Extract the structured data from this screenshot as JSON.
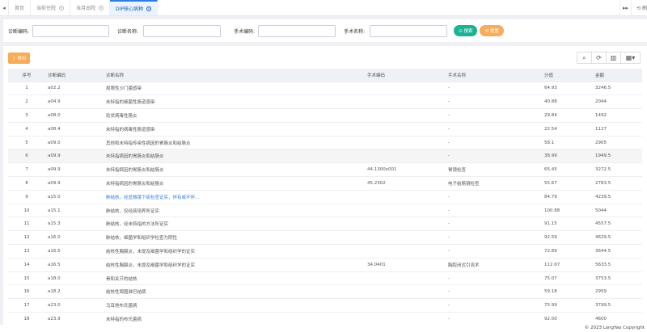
{
  "tabs": {
    "prev": "◂",
    "next": "▸▸",
    "items": [
      {
        "label": "首页"
      },
      {
        "label": "当前住院"
      },
      {
        "label": "当月出院"
      },
      {
        "label": "DIP核心病种"
      }
    ],
    "refresh_label": "⟲ 刷"
  },
  "search": {
    "diag_code_label": "诊断编码:",
    "diag_name_label": "诊断名称:",
    "op_code_label": "手术编码:",
    "op_name_label": "手术名称:",
    "search_button": "⊙ 搜索",
    "reset_button": "⟲ 重置"
  },
  "toolbar": {
    "export_label": "⇪ 导出",
    "search_icon": "⌕",
    "refresh_icon": "⟳",
    "columns_icon": "▥",
    "grid_icon": "▦▾"
  },
  "table": {
    "headers": [
      "序号",
      "诊断编码",
      "诊断名称",
      "手术编码",
      "手术名称",
      "分值",
      "金额"
    ],
    "rows": [
      {
        "no": "1",
        "dcode": "a02.2",
        "dname": "局限性沙门菌感染",
        "ocode": "",
        "oname": "-",
        "score": "64.93",
        "amount": "3246.5",
        "link": false
      },
      {
        "no": "2",
        "dcode": "a04.9",
        "dname": "未特指的细菌性肠道感染",
        "ocode": "",
        "oname": "-",
        "score": "40.88",
        "amount": "2044",
        "link": false
      },
      {
        "no": "3",
        "dcode": "a08.0",
        "dname": "轮状病毒性肠炎",
        "ocode": "",
        "oname": "-",
        "score": "29.84",
        "amount": "1492",
        "link": false
      },
      {
        "no": "4",
        "dcode": "a08.4",
        "dname": "未特指的病毒性肠道感染",
        "ocode": "",
        "oname": "-",
        "score": "22.54",
        "amount": "1127",
        "link": false
      },
      {
        "no": "5",
        "dcode": "a09.0",
        "dname": "其他和未特指传染性病因的胃肠炎和结肠炎",
        "ocode": "",
        "oname": "-",
        "score": "58.1",
        "amount": "2905",
        "link": false
      },
      {
        "no": "6",
        "dcode": "a09.9",
        "dname": "未特指病因的胃肠炎和结肠炎",
        "ocode": "",
        "oname": "-",
        "score": "38.99",
        "amount": "1949.5",
        "link": false
      },
      {
        "no": "7",
        "dcode": "a09.9",
        "dname": "未特指病因的胃肠炎和结肠炎",
        "ocode": "44.1300x001",
        "oname": "胃镜检查",
        "score": "65.45",
        "amount": "3272.5",
        "link": false
      },
      {
        "no": "8",
        "dcode": "a09.9",
        "dname": "未特指病因的胃肠炎和结肠炎",
        "ocode": "45.2302",
        "oname": "电子结肠镜检查",
        "score": "55.67",
        "amount": "2783.5",
        "link": false
      },
      {
        "no": "9",
        "dcode": "a15.0",
        "dname": "肺结核，经显微镜下痰检查证实，伴有或不伴...",
        "ocode": "",
        "oname": "-",
        "score": "84.79",
        "amount": "4239.5",
        "link": true
      },
      {
        "no": "10",
        "dcode": "a15.1",
        "dname": "肺结核，仅经痰培养所证实",
        "ocode": "",
        "oname": "-",
        "score": "100.88",
        "amount": "5044",
        "link": false
      },
      {
        "no": "11",
        "dcode": "a15.3",
        "dname": "肺结核，经未特指的方法所证实",
        "ocode": "",
        "oname": "-",
        "score": "91.15",
        "amount": "4557.5",
        "link": false
      },
      {
        "no": "12",
        "dcode": "a16.0",
        "dname": "肺结核，细菌学和组织学检查为阴性",
        "ocode": "",
        "oname": "-",
        "score": "92.59",
        "amount": "4629.5",
        "link": false
      },
      {
        "no": "13",
        "dcode": "a16.5",
        "dname": "结核性胸膜炎，未提及细菌学和组织学的证实",
        "ocode": "",
        "oname": "-",
        "score": "72.89",
        "amount": "3644.5",
        "link": false
      },
      {
        "no": "14",
        "dcode": "a16.5",
        "dname": "结核性胸膜炎，未提及细菌学和组织学的证实",
        "ocode": "34.0401",
        "oname": "胸腔闭式引流术",
        "score": "112.67",
        "amount": "5633.5",
        "link": false
      },
      {
        "no": "15",
        "dcode": "a18.0",
        "dname": "骨和关节的结核",
        "ocode": "",
        "oname": "-",
        "score": "75.07",
        "amount": "3753.5",
        "link": false
      },
      {
        "no": "16",
        "dcode": "a18.2",
        "dname": "结核性周围淋巴结病",
        "ocode": "",
        "oname": "-",
        "score": "59.18",
        "amount": "2959",
        "link": false
      },
      {
        "no": "17",
        "dcode": "a23.0",
        "dname": "马耳他布氏菌病",
        "ocode": "",
        "oname": "-",
        "score": "75.99",
        "amount": "3799.5",
        "link": false
      },
      {
        "no": "18",
        "dcode": "a23.9",
        "dname": "未特指的布氏菌病",
        "ocode": "",
        "oname": "-",
        "score": "92.00",
        "amount": "4600",
        "link": false
      }
    ]
  },
  "footer": "© 2023 LongYao Copyright"
}
